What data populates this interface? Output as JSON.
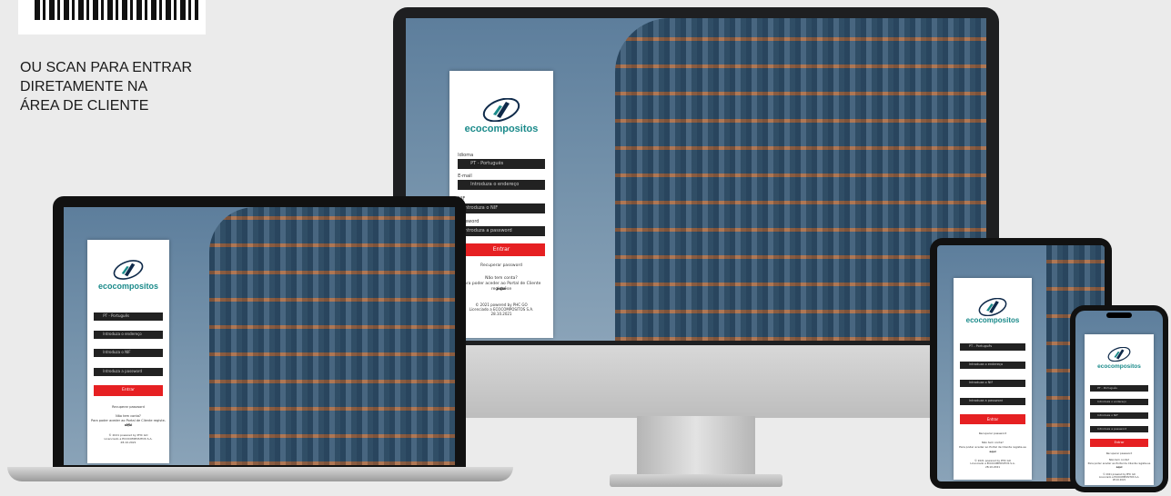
{
  "qr": {
    "caption": "OU SCAN PARA ENTRAR\nDIRETAMENTE NA\nÁREA DE CLIENTE"
  },
  "login": {
    "brand": "ecocompositos",
    "language_label": "Idioma",
    "language_value": "PT - Português",
    "email_label": "E-mail",
    "email_placeholder": "Introduza o endereço",
    "nif_label": "NIF",
    "nif_placeholder": "Introduza o NIF",
    "password_label": "Password",
    "password_placeholder": "Introduza a password",
    "login_button": "Entrar",
    "forgot_password": "Recuperar password",
    "no_account": "Não tem conta?",
    "register_text": "Para poder aceder ao Portal de Cliente registe-se",
    "register_link": "aqui",
    "footer": "© 2021 powered by PHC GO\nLicenciado a ECOCOMPOSITOS S.A.\n28.10.2021"
  },
  "colors": {
    "brand_teal": "#1a8a8a",
    "brand_navy": "#0f2a4a",
    "button_red": "#e62022"
  }
}
